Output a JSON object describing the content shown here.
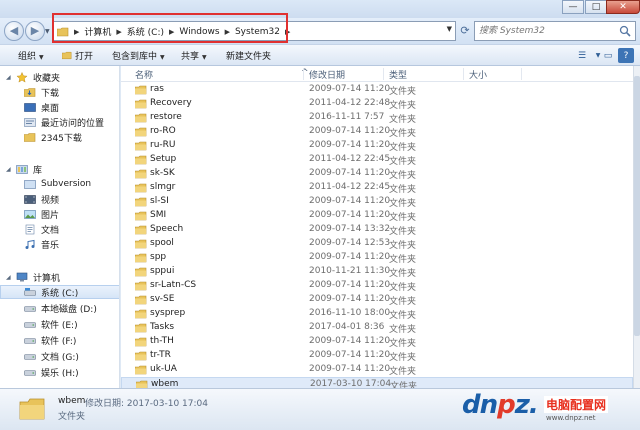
{
  "window": {
    "controls": [
      "—",
      "□",
      "✕"
    ]
  },
  "address": {
    "crumbs": [
      "计算机",
      "系统 (C:)",
      "Windows",
      "System32"
    ],
    "search_placeholder": "搜索 System32"
  },
  "toolbar": {
    "organize": "组织",
    "open": "打开",
    "include_in_library": "包含到库中",
    "share": "共享",
    "new_folder": "新建文件夹"
  },
  "nav": {
    "favorites": {
      "label": "收藏夹",
      "items": [
        "下载",
        "桌面",
        "最近访问的位置",
        "2345下载"
      ]
    },
    "libraries": {
      "label": "库",
      "items": [
        "Subversion",
        "视频",
        "图片",
        "文档",
        "音乐"
      ]
    },
    "computer": {
      "label": "计算机",
      "items": [
        "系统 (C:)",
        "本地磁盘 (D:)",
        "软件 (E:)",
        "软件 (F:)",
        "文档 (G:)",
        "娱乐 (H:)"
      ]
    }
  },
  "columns": {
    "name": "名称",
    "date": "修改日期",
    "type": "类型",
    "size": "大小"
  },
  "files": [
    {
      "name": "ras",
      "date": "2009-07-14 11:20",
      "type": "文件夹"
    },
    {
      "name": "Recovery",
      "date": "2011-04-12 22:48",
      "type": "文件夹"
    },
    {
      "name": "restore",
      "date": "2016-11-11 7:57",
      "type": "文件夹"
    },
    {
      "name": "ro-RO",
      "date": "2009-07-14 11:20",
      "type": "文件夹"
    },
    {
      "name": "ru-RU",
      "date": "2009-07-14 11:20",
      "type": "文件夹"
    },
    {
      "name": "Setup",
      "date": "2011-04-12 22:45",
      "type": "文件夹"
    },
    {
      "name": "sk-SK",
      "date": "2009-07-14 11:20",
      "type": "文件夹"
    },
    {
      "name": "slmgr",
      "date": "2011-04-12 22:45",
      "type": "文件夹"
    },
    {
      "name": "sl-SI",
      "date": "2009-07-14 11:20",
      "type": "文件夹"
    },
    {
      "name": "SMI",
      "date": "2009-07-14 11:20",
      "type": "文件夹"
    },
    {
      "name": "Speech",
      "date": "2009-07-14 13:32",
      "type": "文件夹"
    },
    {
      "name": "spool",
      "date": "2009-07-14 12:53",
      "type": "文件夹"
    },
    {
      "name": "spp",
      "date": "2009-07-14 11:20",
      "type": "文件夹"
    },
    {
      "name": "sppui",
      "date": "2010-11-21 11:30",
      "type": "文件夹"
    },
    {
      "name": "sr-Latn-CS",
      "date": "2009-07-14 11:20",
      "type": "文件夹"
    },
    {
      "name": "sv-SE",
      "date": "2009-07-14 11:20",
      "type": "文件夹"
    },
    {
      "name": "sysprep",
      "date": "2016-11-10 18:00",
      "type": "文件夹"
    },
    {
      "name": "Tasks",
      "date": "2017-04-01 8:36",
      "type": "文件夹"
    },
    {
      "name": "th-TH",
      "date": "2009-07-14 11:20",
      "type": "文件夹"
    },
    {
      "name": "tr-TR",
      "date": "2009-07-14 11:20",
      "type": "文件夹"
    },
    {
      "name": "uk-UA",
      "date": "2009-07-14 11:20",
      "type": "文件夹"
    },
    {
      "name": "wbem",
      "date": "2017-03-10 17:04",
      "type": "文件夹"
    }
  ],
  "details": {
    "name": "wbem",
    "modified": "修改日期: 2017-03-10 17:04",
    "type": "文件夹"
  },
  "watermark": {
    "logo_d": "d",
    "logo_n": "n",
    "logo_o": "p",
    "logo_z": "z",
    "logo_dot": ".",
    "cn": "电脑配置网",
    "url": "www.dnpz.net"
  },
  "colors": {
    "highlight": "#e03030",
    "accent": "#1a5ea8",
    "folder": "#e8c35a"
  }
}
